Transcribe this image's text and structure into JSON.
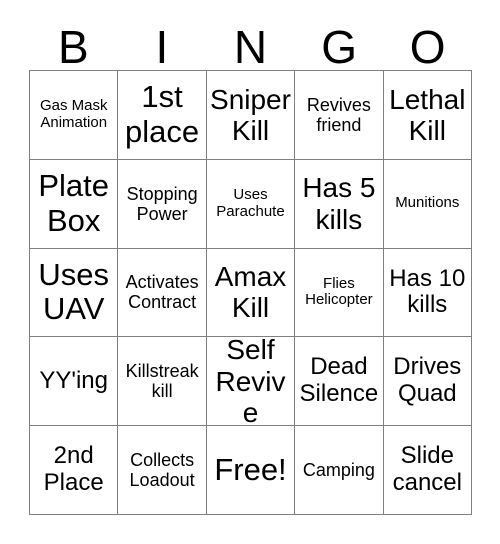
{
  "card": {
    "header_letters": [
      "B",
      "I",
      "N",
      "G",
      "O"
    ],
    "rows": [
      [
        {
          "text": "Gas Mask Animation",
          "size": "xs"
        },
        {
          "text": "1st place",
          "size": "xl"
        },
        {
          "text": "Sniper Kill",
          "size": "lg"
        },
        {
          "text": "Revives friend",
          "size": "sm"
        },
        {
          "text": "Lethal Kill",
          "size": "lg"
        }
      ],
      [
        {
          "text": "Plate Box",
          "size": "xl"
        },
        {
          "text": "Stopping Power",
          "size": "sm"
        },
        {
          "text": "Uses Parachute",
          "size": "xs"
        },
        {
          "text": "Has 5 kills",
          "size": "lg"
        },
        {
          "text": "Munitions",
          "size": "xs"
        }
      ],
      [
        {
          "text": "Uses UAV",
          "size": "xl"
        },
        {
          "text": "Activates Contract",
          "size": "sm"
        },
        {
          "text": "Amax Kill",
          "size": "lg"
        },
        {
          "text": "Flies Helicopter",
          "size": "xs"
        },
        {
          "text": "Has 10 kills",
          "size": "md"
        }
      ],
      [
        {
          "text": "YY'ing",
          "size": "md"
        },
        {
          "text": "Killstreak kill",
          "size": "sm"
        },
        {
          "text": "Self Revive",
          "size": "lg"
        },
        {
          "text": "Dead Silence",
          "size": "md"
        },
        {
          "text": "Drives Quad",
          "size": "md"
        }
      ],
      [
        {
          "text": "2nd Place",
          "size": "md"
        },
        {
          "text": "Collects Loadout",
          "size": "sm"
        },
        {
          "text": "Free!",
          "size": "xl"
        },
        {
          "text": "Camping",
          "size": "sm"
        },
        {
          "text": "Slide cancel",
          "size": "md"
        }
      ]
    ]
  },
  "colors": {
    "background": "#ffffff",
    "text": "#000000",
    "grid_border": "#808080"
  }
}
